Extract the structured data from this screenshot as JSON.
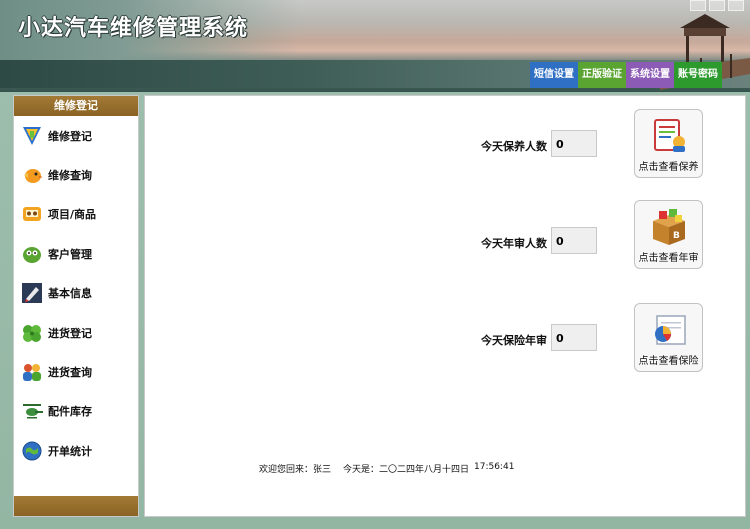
{
  "app": {
    "title": "小达汽车维修管理系统"
  },
  "top_buttons": [
    {
      "label": "短信设置"
    },
    {
      "label": "正版验证"
    },
    {
      "label": "系统设置"
    },
    {
      "label": "账号密码"
    }
  ],
  "sidebar": {
    "title": "维修登记",
    "items": [
      {
        "label": "维修登记",
        "icon": "edit-icon"
      },
      {
        "label": "维修查询",
        "icon": "bird-icon"
      },
      {
        "label": "项目/商品",
        "icon": "tape-icon"
      },
      {
        "label": "客户管理",
        "icon": "customer-icon"
      },
      {
        "label": "基本信息",
        "icon": "pen-icon"
      },
      {
        "label": "进货登记",
        "icon": "clover-icon"
      },
      {
        "label": "进货查询",
        "icon": "users-icon"
      },
      {
        "label": "配件库存",
        "icon": "helicopter-icon"
      },
      {
        "label": "开单统计",
        "icon": "globe-icon"
      }
    ]
  },
  "main": {
    "rows": [
      {
        "label": "今天保养人数",
        "value": "0",
        "button": "点击查看保养",
        "icon": "document-icon"
      },
      {
        "label": "今天年审人数",
        "value": "0",
        "button": "点击查看年审",
        "icon": "box-icon"
      },
      {
        "label": "今天保险年审",
        "value": "0",
        "button": "点击查看保险",
        "icon": "chart-icon"
      }
    ]
  },
  "status": {
    "welcome": "欢迎您回来：张三",
    "date": "今天是：二〇二四年八月十四日",
    "time": "17:56:41"
  },
  "colors": {
    "sidebar_header": "#9a7030",
    "btn_sms": "#2f6fc4",
    "btn_reg": "#5aa431",
    "btn_sys": "#8b5bb6",
    "btn_acc": "#2c9a2c"
  }
}
